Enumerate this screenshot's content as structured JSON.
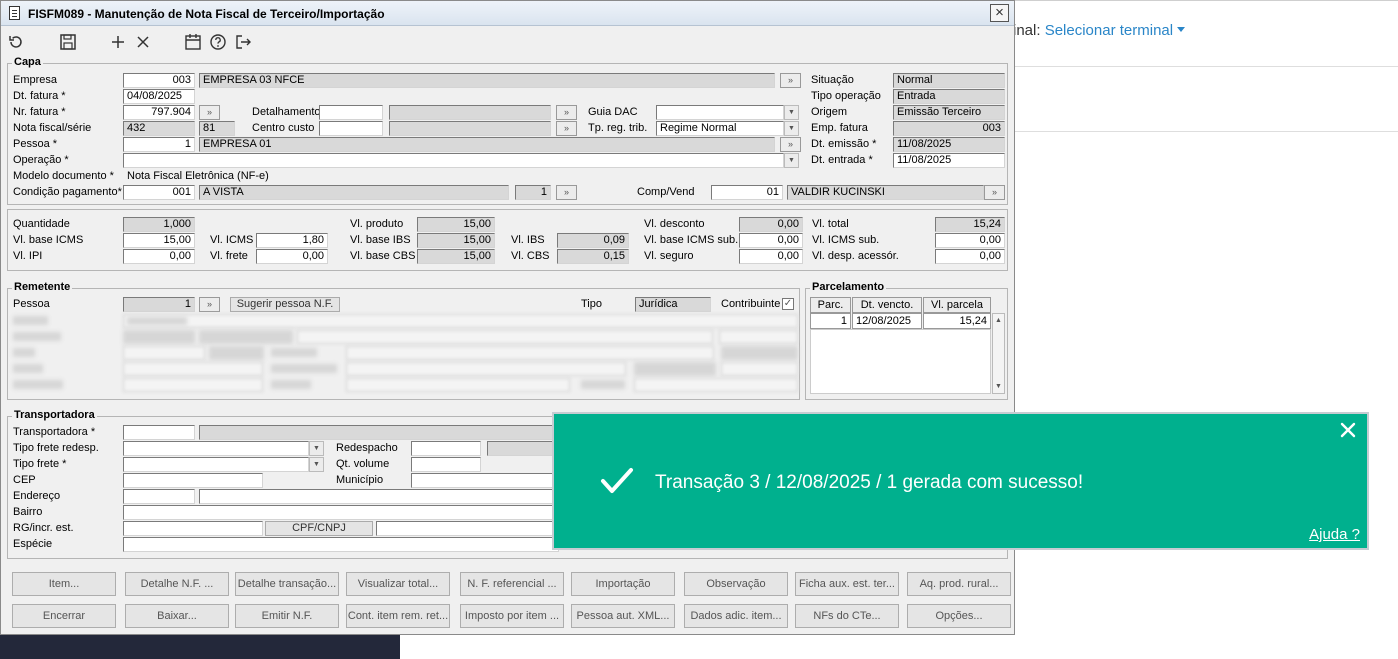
{
  "background": {
    "terminal_label": "inal:",
    "terminal_link": "Selecionar terminal"
  },
  "window": {
    "title": "FISFM089 - Manutenção de Nota Fiscal de Terceiro/Importação",
    "close": "×"
  },
  "toolbar": {
    "icons": [
      "refresh-icon",
      "save-icon",
      "add-icon",
      "delete-icon",
      "calendar-icon",
      "help-icon",
      "exit-icon"
    ]
  },
  "capa": {
    "legend": "Capa",
    "empresa_label": "Empresa",
    "empresa_code": "003",
    "empresa_name": "EMPRESA 03 NFCE",
    "dt_fatura_label": "Dt. fatura *",
    "dt_fatura": "04/08/2025",
    "nr_fatura_label": "Nr. fatura *",
    "nr_fatura": "797.904",
    "detalhamento_label": "Detalhamento",
    "guia_dac_label": "Guia DAC",
    "nota_serie_label": "Nota fiscal/série",
    "nota": "432",
    "serie": "81",
    "centro_custo_label": "Centro custo",
    "tp_reg_label": "Tp. reg. trib.",
    "tp_reg": "Regime Normal",
    "pessoa_label": "Pessoa *",
    "pessoa_code": "1",
    "pessoa_name": "EMPRESA 01",
    "operacao_label": "Operação *",
    "modelo_label": "Modelo documento *",
    "modelo": "Nota Fiscal Eletrônica (NF-e)",
    "condicao_label": "Condição pagamento*",
    "condicao_code": "001",
    "condicao_name": "A VISTA",
    "condicao_n": "1",
    "comp_vend_label": "Comp/Vend",
    "comp_vend_code": "01",
    "comp_vend_name": "VALDIR KUCINSKI",
    "situacao_label": "Situação",
    "situacao": "Normal",
    "tipo_op_label": "Tipo operação",
    "tipo_op": "Entrada",
    "origem_label": "Origem",
    "origem": "Emissão Terceiro",
    "emp_fatura_label": "Emp. fatura",
    "emp_fatura": "003",
    "dt_emissao_label": "Dt. emissão *",
    "dt_emissao": "11/08/2025",
    "dt_entrada_label": "Dt. entrada *",
    "dt_entrada": "11/08/2025"
  },
  "valores": {
    "quantidade_label": "Quantidade",
    "quantidade": "1,000",
    "base_icms_label": "Vl. base ICMS",
    "base_icms": "15,00",
    "ipi_label": "Vl. IPI",
    "ipi": "0,00",
    "icms_label": "Vl. ICMS",
    "icms": "1,80",
    "frete_label": "Vl. frete",
    "frete": "0,00",
    "produto_label": "Vl. produto",
    "produto": "15,00",
    "base_ibs_label": "Vl. base IBS",
    "base_ibs": "15,00",
    "base_cbs_label": "Vl. base CBS",
    "base_cbs": "15,00",
    "ibs_label": "Vl. IBS",
    "ibs": "0,09",
    "cbs_label": "Vl. CBS",
    "cbs": "0,15",
    "desconto_label": "Vl. desconto",
    "desconto": "0,00",
    "base_icms_sub_label": "Vl. base ICMS sub.",
    "base_icms_sub": "0,00",
    "seguro_label": "Vl. seguro",
    "seguro": "0,00",
    "total_label": "Vl. total",
    "total": "15,24",
    "icms_sub_label": "Vl. ICMS sub.",
    "icms_sub": "0,00",
    "desp_label": "Vl. desp. acessór.",
    "desp": "0,00"
  },
  "remetente": {
    "legend": "Remetente",
    "pessoa_label": "Pessoa",
    "pessoa_code": "1",
    "sugerir_label": "Sugerir pessoa N.F.",
    "tipo_label": "Tipo",
    "tipo": "Jurídica",
    "contribuinte_label": "Contribuinte",
    "contribuinte_check": "✓"
  },
  "parcelamento": {
    "legend": "Parcelamento",
    "headers": [
      "Parc.",
      "Dt. vencto.",
      "Vl. parcela"
    ],
    "row": [
      "1",
      "12/08/2025",
      "15,24"
    ]
  },
  "transportadora": {
    "legend": "Transportadora",
    "transp_label": "Transportadora *",
    "tipo_frete_redesp_label": "Tipo frete redesp.",
    "redespacho_label": "Redespacho",
    "tipo_frete_label": "Tipo frete *",
    "qt_volume_label": "Qt. volume",
    "cep_label": "CEP",
    "municipio_label": "Município",
    "endereco_label": "Endereço",
    "bairro_label": "Bairro",
    "rg_label": "RG/incr. est.",
    "cpf_cnpj_label": "CPF/CNPJ",
    "especie_label": "Espécie"
  },
  "buttons_row1": [
    "Item...",
    "Detalhe N.F. ...",
    "Detalhe transação...",
    "Visualizar total...",
    "N. F. referencial ...",
    "Importação",
    "Observação",
    "Ficha aux. est. ter...",
    "Aq. prod. rural..."
  ],
  "buttons_row2": [
    "Encerrar",
    "Baixar...",
    "Emitir N.F.",
    "Cont. item rem. ret...",
    "Imposto por item ...",
    "Pessoa aut. XML...",
    "Dados adic. item...",
    "NFs do CTe...",
    "Opções..."
  ],
  "toast": {
    "message": "Transação 3 / 12/08/2025 / 1 gerada com sucesso!",
    "help": "Ajuda ?",
    "color": "#00b08e"
  }
}
